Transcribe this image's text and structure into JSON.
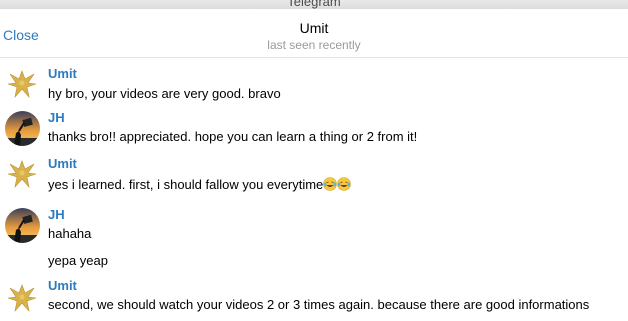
{
  "window": {
    "title": "Telegram"
  },
  "header": {
    "close_label": "Close",
    "title": "Umit",
    "status": "last seen recently"
  },
  "messages": [
    {
      "sender": "Umit",
      "avatar": "eagle-avatar",
      "lines": [
        "hy bro, your videos are very good. bravo"
      ]
    },
    {
      "sender": "JH",
      "avatar": "sunset-person-avatar",
      "lines": [
        "thanks bro!! appreciated. hope you can learn a thing or 2 from it!"
      ]
    },
    {
      "sender": "Umit",
      "avatar": "eagle-avatar",
      "lines": [
        "yes i learned. first, i should fallow you everytime"
      ],
      "emojis": [
        "laughing-tears-emoji",
        "laughing-tears-emoji"
      ]
    },
    {
      "sender": "JH",
      "avatar": "sunset-person-avatar",
      "lines": [
        "hahaha",
        "yepa yeap"
      ]
    },
    {
      "sender": "Umit",
      "avatar": "eagle-avatar",
      "lines": [
        "second, we should watch your videos 2 or 3 times again. because there are good informations"
      ]
    }
  ]
}
